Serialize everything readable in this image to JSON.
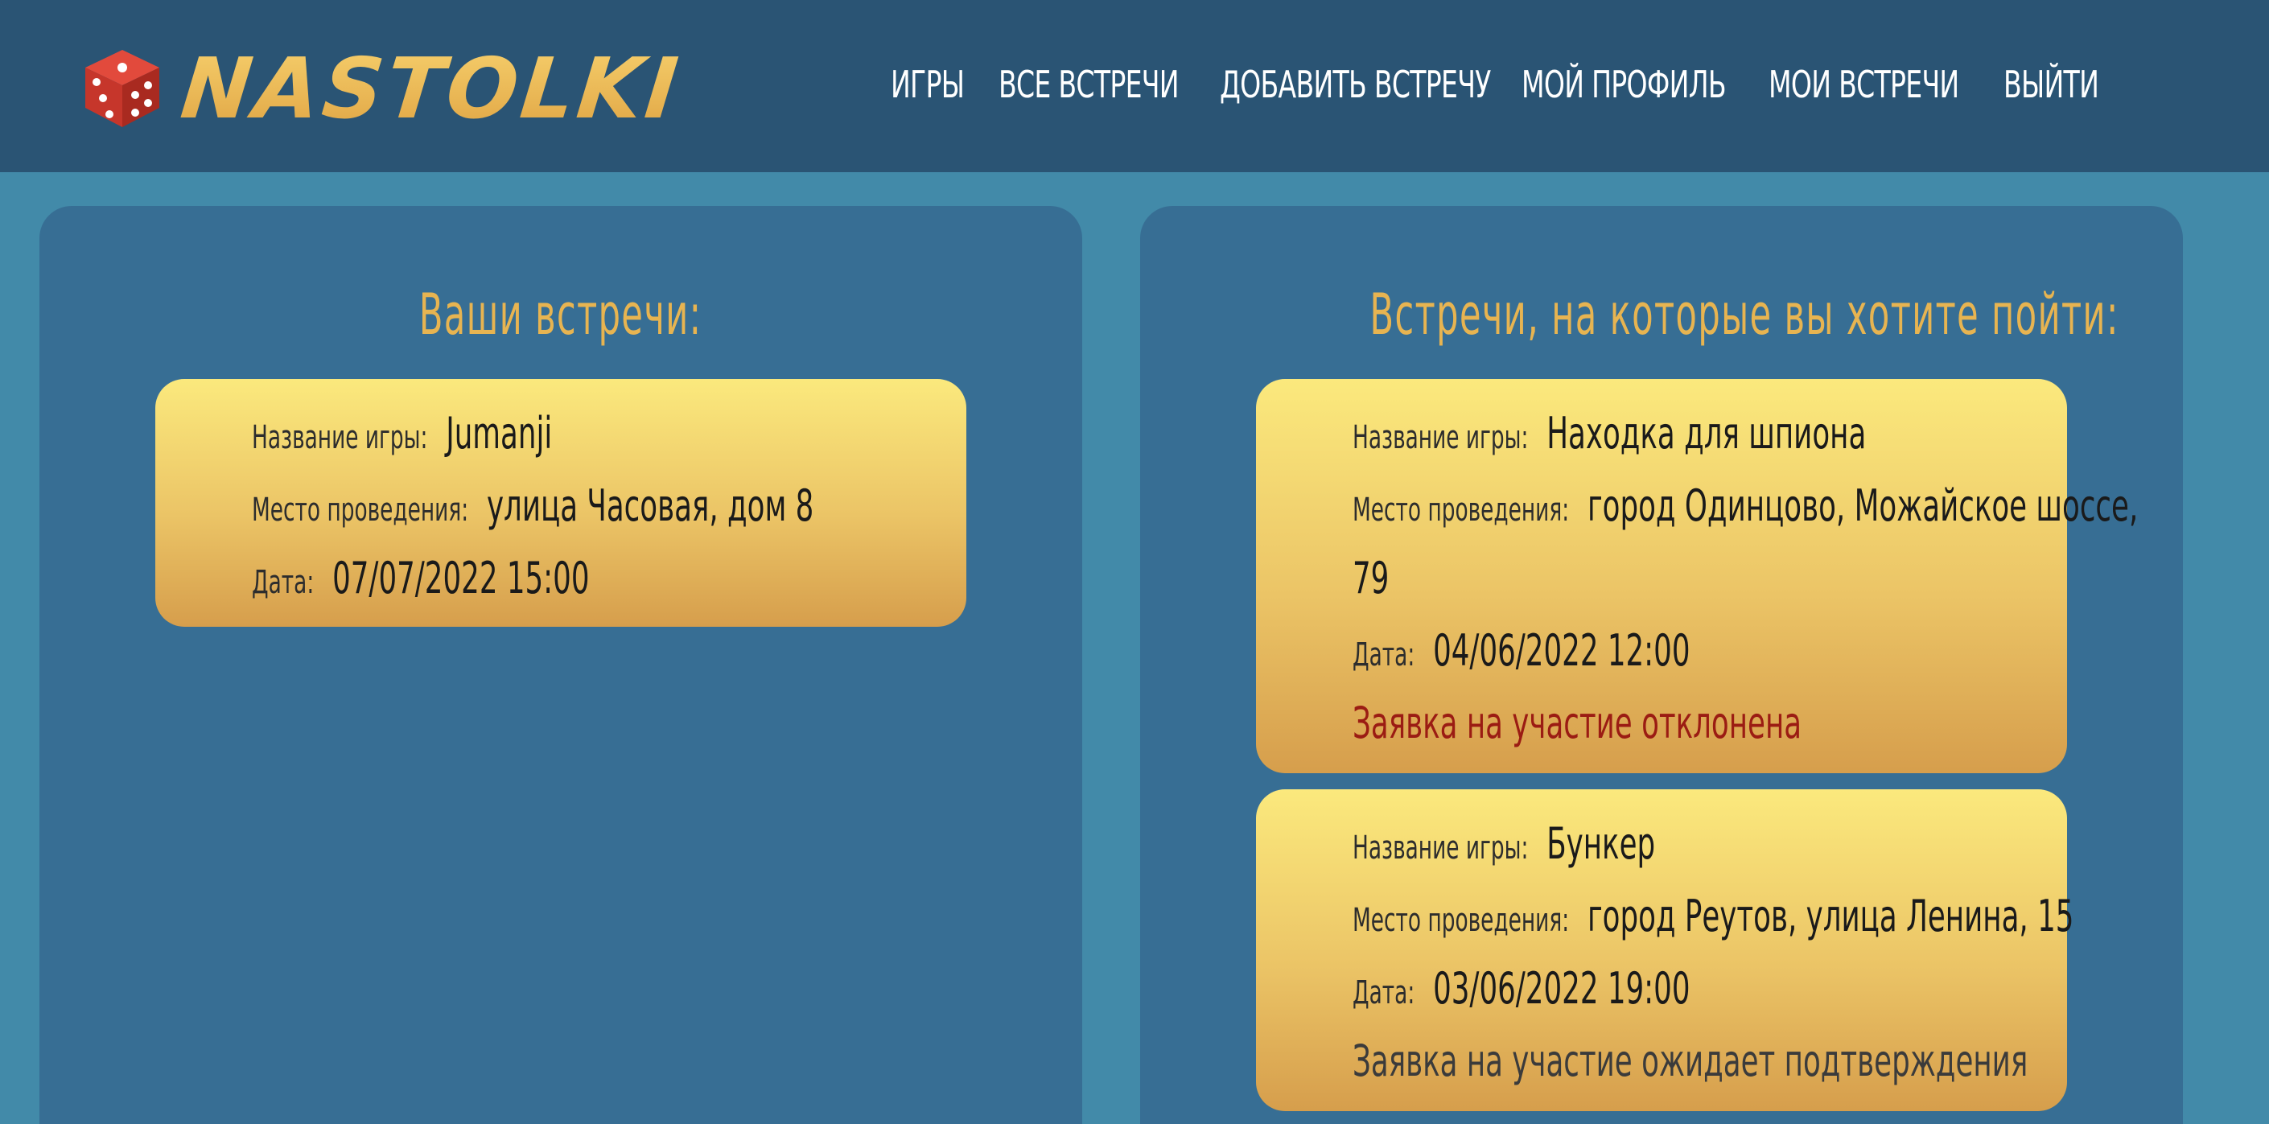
{
  "header": {
    "logo_text": "NASTOLKI",
    "nav": [
      {
        "label": "ИГРЫ"
      },
      {
        "label": "ВСЕ ВСТРЕЧИ"
      },
      {
        "label": "ДОБАВИТЬ ВСТРЕЧУ"
      },
      {
        "label": "МОЙ ПРОФИЛЬ"
      },
      {
        "label": "МОИ ВСТРЕЧИ"
      },
      {
        "label": "ВЫЙТИ"
      }
    ]
  },
  "colors": {
    "page_bg": "#428aa9",
    "header_bg": "#2a5474",
    "panel_bg": "#376e94",
    "accent_gold": "#e7b451",
    "declined": "#9b1c13",
    "pending": "#3b3b3b"
  },
  "icons": {
    "logo": "dice-icon"
  },
  "my_meetings": {
    "title": "Ваши встречи:",
    "items": [
      {
        "game_label": "Название игры:",
        "game": "Jumanji",
        "place_label": "Место проведения:",
        "place": "улица Часовая, дом 8",
        "date_label": "Дата:",
        "date": "07/07/2022 15:00"
      }
    ]
  },
  "wanted_meetings": {
    "title": "Встречи, на которые вы хотите пойти:",
    "items": [
      {
        "game_label": "Название игры:",
        "game": "Находка для шпиона",
        "place_label": "Место проведения:",
        "place": "город Одинцово, Можайское шоссе,",
        "place_cont": "79",
        "date_label": "Дата:",
        "date": "04/06/2022 12:00",
        "status": "Заявка на участие отклонена"
      },
      {
        "game_label": "Название игры:",
        "game": "Бункер",
        "place_label": "Место проведения:",
        "place": "город Реутов, улица Ленина, 15",
        "date_label": "Дата:",
        "date": "03/06/2022 19:00",
        "status": "Заявка на участие ожидает подтверждения"
      }
    ]
  }
}
